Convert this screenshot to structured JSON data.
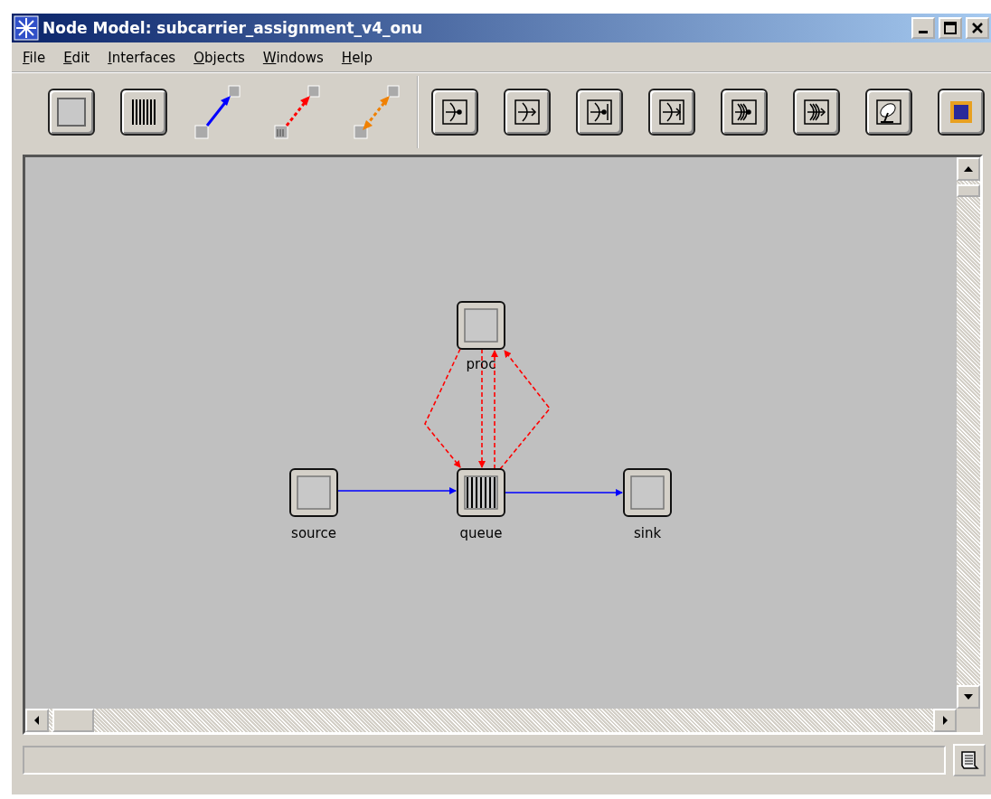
{
  "window": {
    "title": "Node Model: subcarrier_assignment_v4_onu"
  },
  "menu": [
    "File",
    "Edit",
    "Interfaces",
    "Objects",
    "Windows",
    "Help"
  ],
  "nodes": [
    {
      "label": "proc",
      "kind": "processor"
    },
    {
      "label": "source",
      "kind": "processor"
    },
    {
      "label": "queue",
      "kind": "queue"
    },
    {
      "label": "sink",
      "kind": "processor"
    }
  ],
  "links": [
    {
      "kind": "stream"
    },
    {
      "kind": "stream"
    },
    {
      "kind": "statwire"
    },
    {
      "kind": "statwire"
    },
    {
      "kind": "statwire"
    },
    {
      "kind": "statwire"
    }
  ]
}
